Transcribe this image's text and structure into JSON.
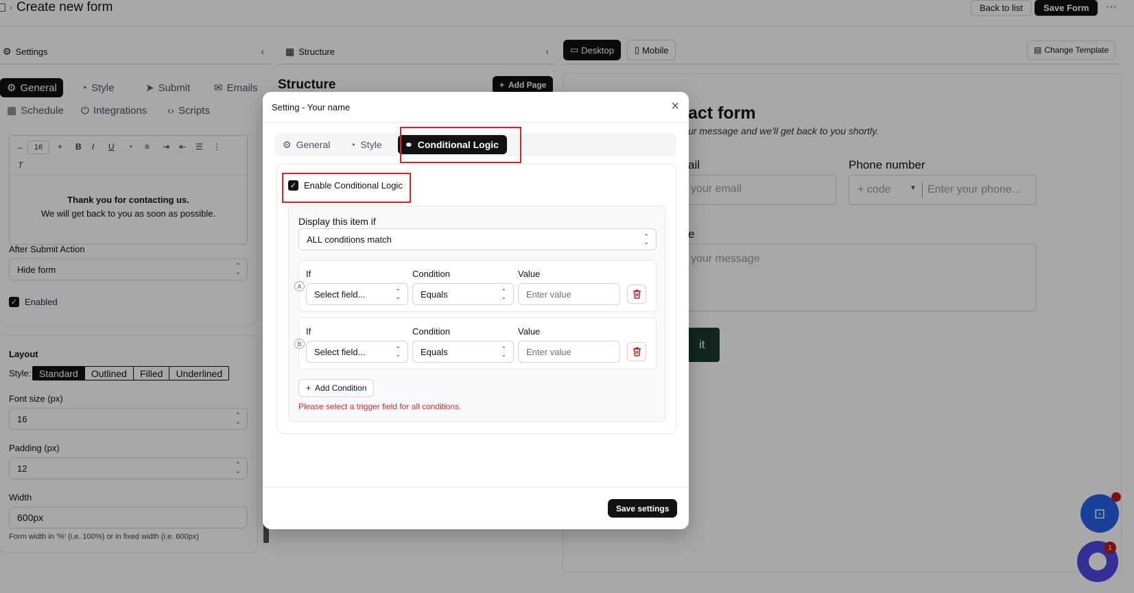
{
  "header": {
    "page_title": "Create new form",
    "back_label": "Back to list",
    "save_label": "Save Form",
    "more_icon": "more-horizontal-icon"
  },
  "settings_panel": {
    "title": "Settings",
    "tabs_row1": [
      "General",
      "Style",
      "Submit",
      "Emails"
    ],
    "tabs_row2": [
      "Schedule",
      "Integrations",
      "Scripts"
    ],
    "editor_font_size": "16",
    "message_line1": "Thank you for contacting us.",
    "message_line2": "We will get back to you as soon as possible.",
    "after_submit_label": "After Submit Action",
    "after_submit_value": "Hide form",
    "enabled_label": "Enabled",
    "layout_title": "Layout",
    "style_label": "Style:",
    "style_options": [
      "Standard",
      "Outlined",
      "Filled",
      "Underlined"
    ],
    "font_size_label": "Font size (px)",
    "font_size_value": "16",
    "padding_label": "Padding (px)",
    "padding_value": "12",
    "width_label": "Width",
    "width_value": "600px",
    "width_help": "Form width in '%' (i.e. 100%) or in fixed width (i.e. 600px)"
  },
  "structure_panel": {
    "title": "Structure",
    "heading": "Structure",
    "add_page_label": "Add Page"
  },
  "preview_panel": {
    "desktop_label": "Desktop",
    "mobile_label": "Mobile",
    "change_template_label": "Change Template",
    "form_title_partial": "act form",
    "form_subtitle_partial": "ur message and we'll get back to you shortly.",
    "email_label_partial": "ail",
    "email_placeholder_partial": "your email",
    "phone_label": "Phone number",
    "phone_code": "+ code",
    "phone_placeholder": "Enter your phone...",
    "message_label_partial": "e",
    "message_placeholder_partial": "your message",
    "submit_partial": "it"
  },
  "modal": {
    "title": "Setting - Your name",
    "tabs": [
      "General",
      "Style",
      "Conditional Logic"
    ],
    "enable_label": "Enable Conditional Logic",
    "display_label": "Display this item if",
    "match_value": "ALL conditions match",
    "col_if": "If",
    "col_condition": "Condition",
    "col_value": "Value",
    "rows": [
      {
        "letter": "A",
        "field": "Select field...",
        "condition": "Equals",
        "value_placeholder": "Enter value"
      },
      {
        "letter": "B",
        "field": "Select field...",
        "condition": "Equals",
        "value_placeholder": "Enter value"
      }
    ],
    "add_condition_label": "Add Condition",
    "error_text": "Please select a trigger field for all conditions.",
    "save_label": "Save settings"
  },
  "chat_badge_count": "1",
  "colors": {
    "accent": "#111111",
    "error": "#dc2626",
    "highlight": "#e11d1d",
    "fab_blue": "#2563eb",
    "fab_purple": "#4f46e5"
  }
}
